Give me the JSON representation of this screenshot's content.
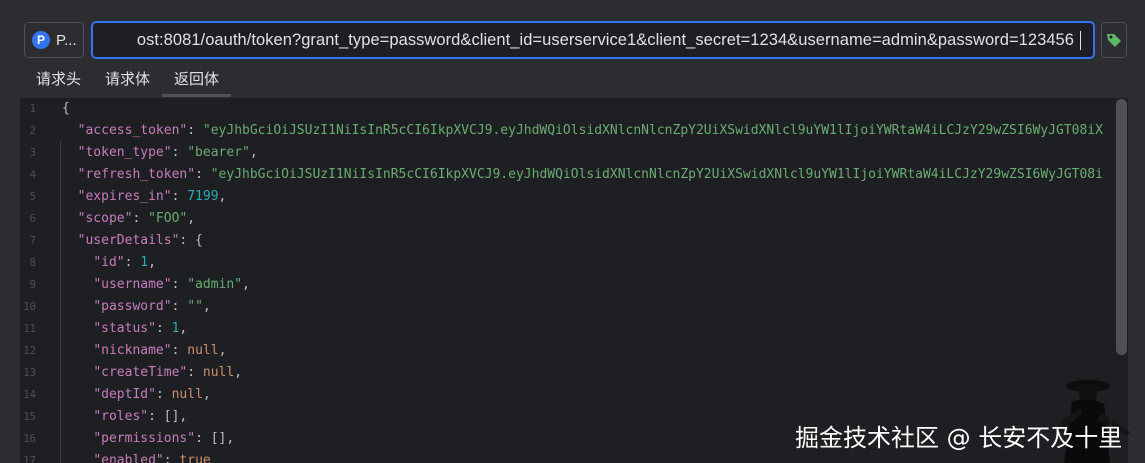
{
  "request": {
    "method_badge": "P",
    "method_label": "P...",
    "url": "ost:8081/oauth/token?grant_type=password&client_id=userservice1&client_secret=1234&username=admin&password=123456",
    "send_icon": "tag-icon"
  },
  "tabs": [
    {
      "label": "请求头"
    },
    {
      "label": "请求体"
    },
    {
      "label": "返回体"
    }
  ],
  "active_tab": "返回体",
  "response": {
    "line_numbers": [
      "1",
      "2",
      "3",
      "4",
      "5",
      "6",
      "7",
      "8",
      "9",
      "10",
      "11",
      "12",
      "13",
      "14",
      "15",
      "16",
      "17"
    ],
    "access_token": "\"eyJhbGciOiJSUzI1NiIsInR5cCI6IkpXVCJ9.eyJhdWQiOlsidXNlcnNlcnZpY2UiXSwidXNlcl9uYW1lIjoiYWRtaW4iLCJzY29wZSI6WyJGT08iX",
    "token_type": "\"bearer\"",
    "refresh_token": "\"eyJhbGciOiJSUzI1NiIsInR5cCI6IkpXVCJ9.eyJhdWQiOlsidXNlcnNlcnZpY2UiXSwidXNlcl9uYW1lIjoiYWRtaW4iLCJzY29wZSI6WyJGT08i",
    "expires_in": "7199",
    "scope": "\"FOO\"",
    "id": "1",
    "username": "\"admin\"",
    "password": "\"\"",
    "status": "1",
    "null_value": "null",
    "true_value": "true"
  },
  "watermark": "掘金技术社区 @ 长安不及十里"
}
